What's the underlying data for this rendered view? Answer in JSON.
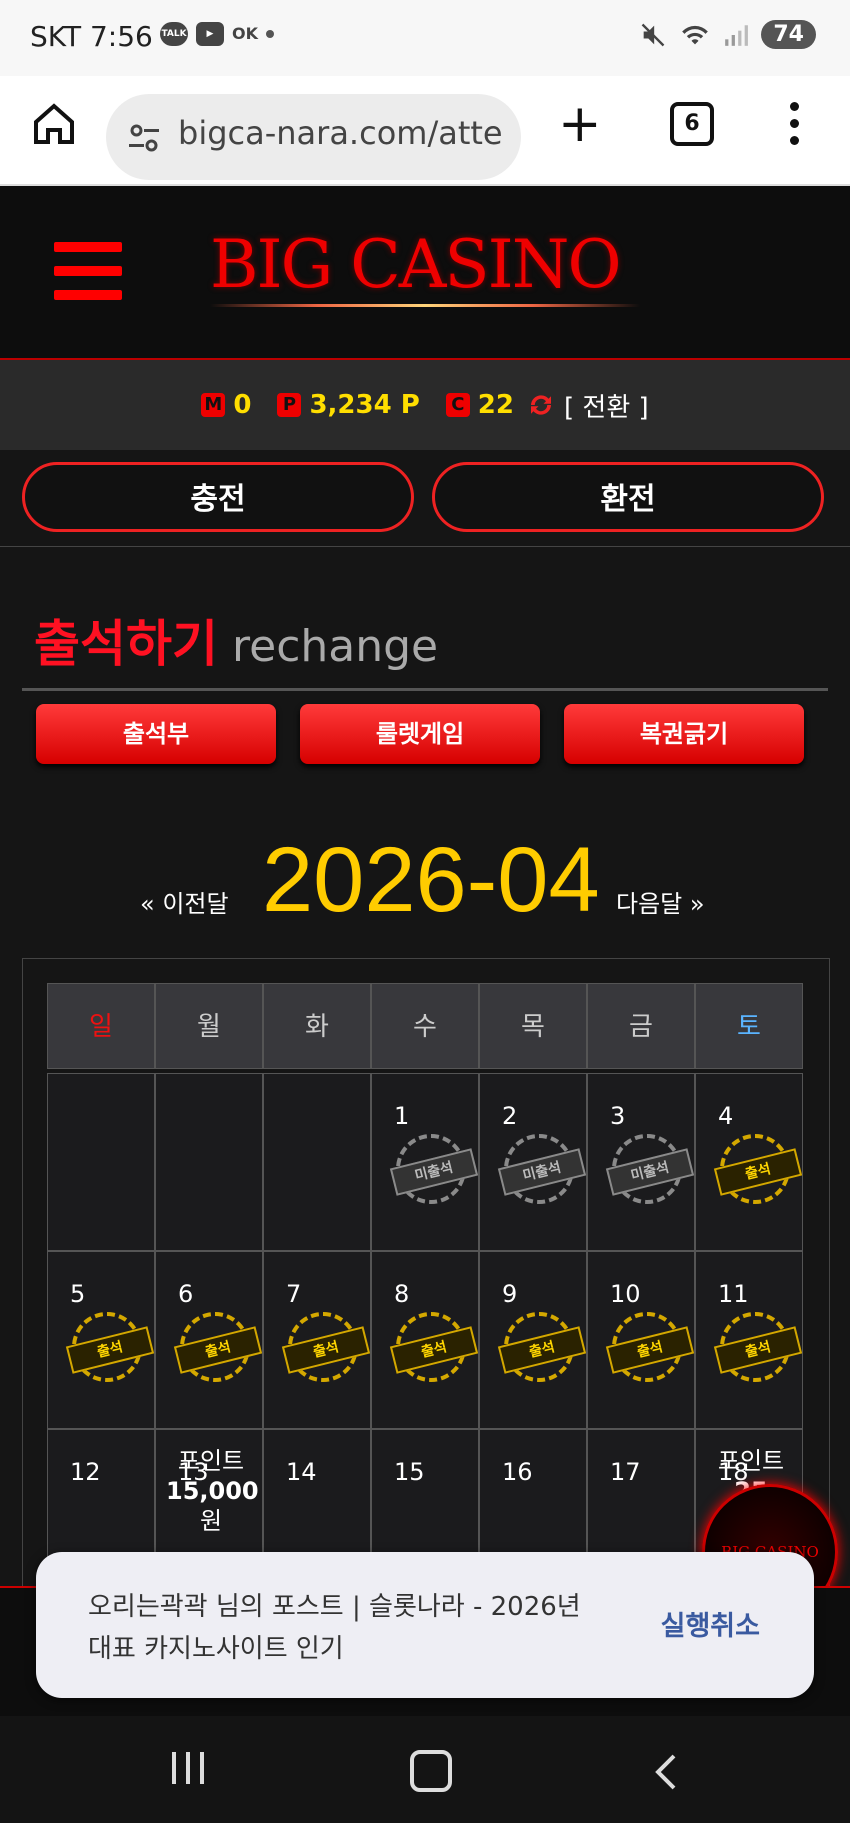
{
  "status": {
    "time": "SKT 7:56",
    "battery": "74"
  },
  "browser": {
    "url": "bigca-nara.com/atte",
    "tab_count": "6"
  },
  "site": {
    "logo": "BIG CASINO"
  },
  "balance": {
    "m_label": "M",
    "m_value": "0",
    "p_label": "P",
    "p_value": "3,234 P",
    "c_label": "C",
    "c_value": "22",
    "convert": "[ 전환 ]"
  },
  "buttons": {
    "charge": "충전",
    "exchange": "환전"
  },
  "section": {
    "title_ko": "출석하기",
    "title_en": "rechange"
  },
  "tabs": [
    "출석부",
    "룰렛게임",
    "복권긁기"
  ],
  "calendar": {
    "prev": "« 이전달",
    "month": "2026-04",
    "next": "다음달 »",
    "weekdays": [
      "일",
      "월",
      "화",
      "수",
      "목",
      "금",
      "토"
    ],
    "weekday_colors": {
      "sun": "#ee1111",
      "sat": "#5ab4ff",
      "other": "#cccccc"
    },
    "week1": [
      "",
      "",
      "",
      "1",
      "2",
      "3",
      "4"
    ],
    "week2": [
      "5",
      "6",
      "7",
      "8",
      "9",
      "10",
      "11"
    ],
    "week3": [
      "12",
      "13",
      "14",
      "15",
      "16",
      "17",
      "18"
    ],
    "stamp_absent": "미출석",
    "stamp_present": "출석",
    "point_label": "포인트",
    "point_13": "15,000",
    "point_18": "25",
    "won": "원"
  },
  "toast": {
    "message": "오리는곽곽 님의 포스트 | 슬롯나라 - 2026년 대표 카지노사이트 인기",
    "action": "실행취소"
  }
}
